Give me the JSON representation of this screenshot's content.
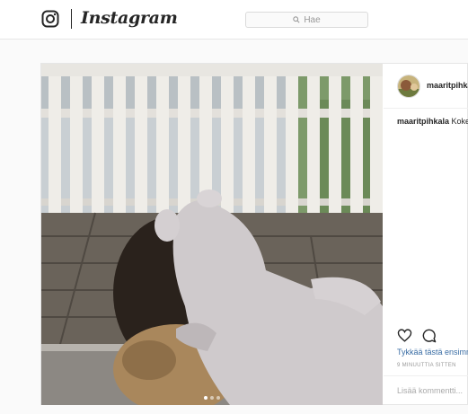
{
  "header": {
    "logo_icon": "instagram-camera-icon",
    "logo_text": "Instagram",
    "search_placeholder": "Hae",
    "search_icon": "search-icon"
  },
  "post": {
    "username": "maaritpihkala",
    "caption_user": "maaritpihkala",
    "caption_text": " Kokeil",
    "likes_text": "Tykkää tästä ensimm",
    "time_text": "9 MINUUTTIA SITTEN",
    "comment_placeholder": "Lisää kommentti...",
    "carousel": {
      "count": 3,
      "active": 1
    },
    "icons": [
      "heart-icon",
      "comment-icon"
    ]
  },
  "colors": {
    "like_link": "#3b6ea5",
    "border": "#e6e6e6",
    "text": "#262626"
  }
}
